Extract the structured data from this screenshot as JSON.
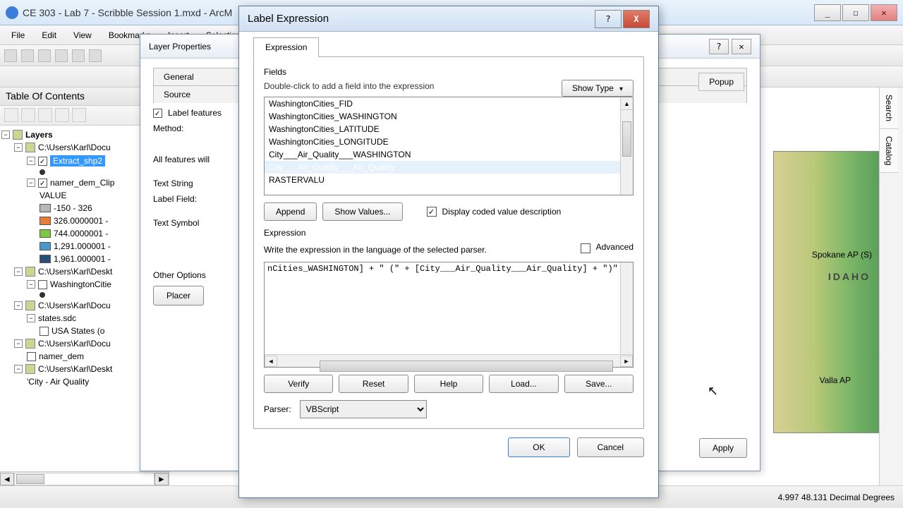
{
  "app": {
    "title": "CE 303 - Lab 7 - Scribble Session 1.mxd - ArcM"
  },
  "menubar": [
    "File",
    "Edit",
    "View",
    "Bookmarks",
    "Insert",
    "Selection"
  ],
  "toc": {
    "title": "Table Of Contents",
    "root": "Layers",
    "items": [
      {
        "type": "grp",
        "label": "C:\\Users\\Karl\\Docu"
      },
      {
        "type": "lyr",
        "label": "Extract_shp2",
        "selected": true,
        "checked": true
      },
      {
        "type": "sym",
        "shape": "dot"
      },
      {
        "type": "lyr",
        "label": "namer_dem_Clip",
        "checked": true
      },
      {
        "type": "hdr",
        "label": "VALUE"
      },
      {
        "type": "leg",
        "color": "#b7b7b7",
        "label": "-150 - 326"
      },
      {
        "type": "leg",
        "color": "#e87c3a",
        "label": "326.0000001 -"
      },
      {
        "type": "leg",
        "color": "#7cc941",
        "label": "744.0000001 -"
      },
      {
        "type": "leg",
        "color": "#4b97d2",
        "label": "1,291.000001 -"
      },
      {
        "type": "leg",
        "color": "#274f74",
        "label": "1,961.000001 -"
      },
      {
        "type": "grp",
        "label": "C:\\Users\\Karl\\Deskt"
      },
      {
        "type": "lyr",
        "label": "WashingtonCitie",
        "checked": false
      },
      {
        "type": "sym",
        "shape": "dot"
      },
      {
        "type": "grp",
        "label": "C:\\Users\\Karl\\Docu"
      },
      {
        "type": "lyr",
        "label": "states.sdc",
        "plain": true
      },
      {
        "type": "lyr",
        "label": "USA States (o",
        "checked": false,
        "sub": true
      },
      {
        "type": "grp",
        "label": "C:\\Users\\Karl\\Docu"
      },
      {
        "type": "lyr",
        "label": "namer_dem",
        "checked": false
      },
      {
        "type": "grp",
        "label": "C:\\Users\\Karl\\Deskt"
      },
      {
        "type": "lyr",
        "label": "'City - Air Quality",
        "plain": true
      }
    ]
  },
  "map": {
    "label_spokane": "Spokane AP (S)",
    "label_idaho": "IDAHO",
    "label_walla": "Valla AP"
  },
  "sidetabs": [
    "Search",
    "Catalog"
  ],
  "statusbar": "4.997  48.131 Decimal Degrees",
  "layerprops": {
    "title": "Layer Properties",
    "tabs": [
      "General",
      "Source"
    ],
    "popup": "Popup",
    "label_features": "Label features",
    "method": "Method:",
    "all_features": "All features will",
    "text_string": "Text String",
    "label_field": "Label Field:",
    "text_symbol": "Text Symbol",
    "other_options": "Other Options",
    "placement": "Placer",
    "apply": "Apply"
  },
  "labeldlg": {
    "title": "Label Expression",
    "tab": "Expression",
    "fields_header": "Fields",
    "fields_hint": "Double-click to add a field into the expression",
    "show_type": "Show Type",
    "fields": [
      "WashingtonCities_FID",
      "WashingtonCities_WASHINGTON",
      "WashingtonCities_LATITUDE",
      "WashingtonCities_LONGITUDE",
      "City___Air_Quality___WASHINGTON",
      "City___Air_Quality___Air_Quality",
      "RASTERVALU"
    ],
    "append": "Append",
    "show_values": "Show Values...",
    "display_coded": "Display coded value description",
    "expression_header": "Expression",
    "expression_hint": "Write the expression in the language of the selected parser.",
    "advanced": "Advanced",
    "expression_text": "nCities_WASHINGTON] + \" (\" + [City___Air_Quality___Air_Quality]  + \")\"",
    "buttons": [
      "Verify",
      "Reset",
      "Help",
      "Load...",
      "Save..."
    ],
    "parser_label": "Parser:",
    "parser_value": "VBScript",
    "ok": "OK",
    "cancel": "Cancel"
  }
}
